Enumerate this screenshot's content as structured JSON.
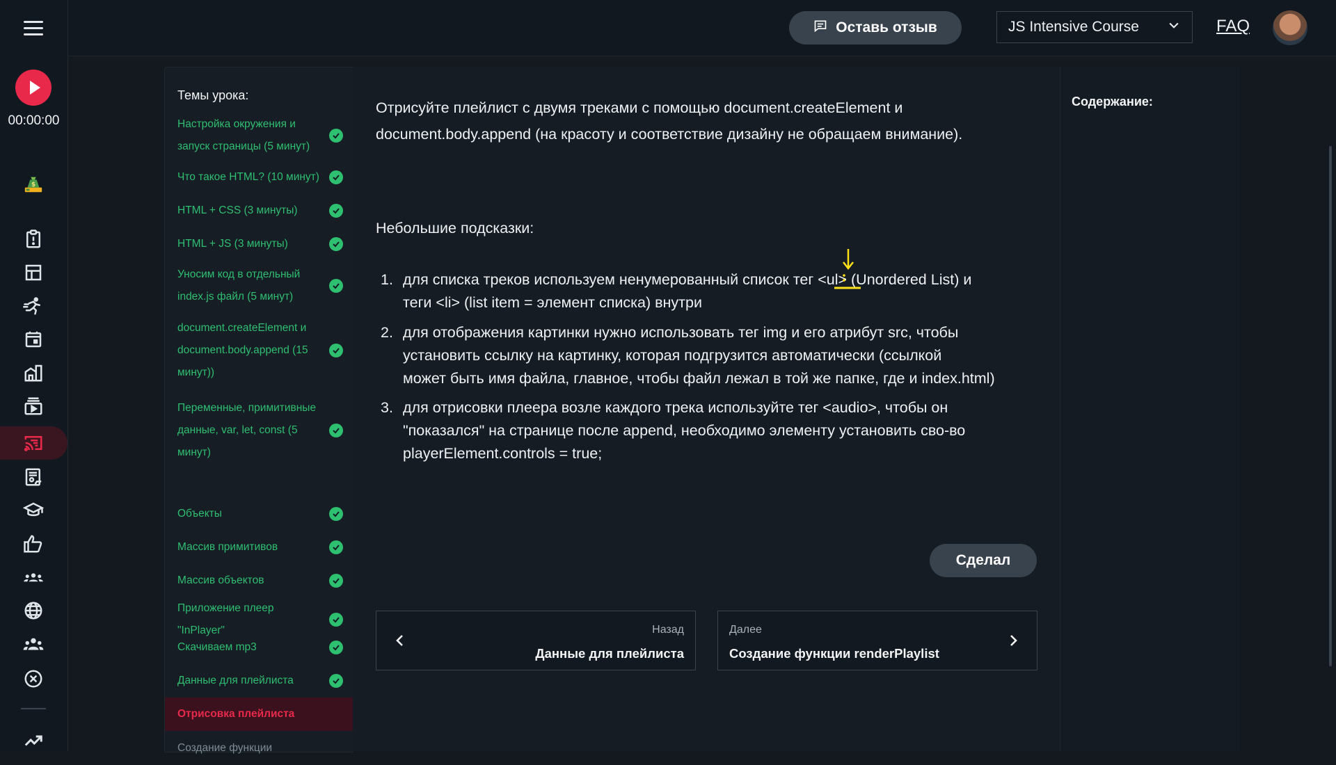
{
  "player": {
    "timer": "00:00:00"
  },
  "header": {
    "feedback_label": "Оставь отзыв",
    "course_selected": "JS Intensive Course",
    "faq_label": "FAQ"
  },
  "topics": {
    "title": "Темы урока:",
    "items": [
      {
        "label": "Настройка окружения и запуск страницы (5 минут)",
        "done": true
      },
      {
        "label": "Что такое HTML? (10 минут)",
        "done": true
      },
      {
        "label": "HTML + CSS (3 минуты)",
        "done": true
      },
      {
        "label": "HTML + JS (3 минуты)",
        "done": true
      },
      {
        "label": "Уносим код в отдельный index.js файл (5 минут)",
        "done": true
      },
      {
        "label": "document.createElement и document.body.append (15 минут))",
        "done": true
      },
      {
        "label": "Переменные, примитивные данные, var, let, const (5 минут)",
        "done": true
      },
      {
        "label": "Объекты",
        "done": true
      },
      {
        "label": "Массив примитивов",
        "done": true
      },
      {
        "label": "Массив объектов",
        "done": true
      },
      {
        "label": "Приложение плеер \"InPlayer\"",
        "done": true
      },
      {
        "label": "Скачиваем mp3",
        "done": true
      },
      {
        "label": "Данные для плейлиста",
        "done": true
      },
      {
        "label": "Отрисовка плейлиста",
        "done": false,
        "active": true
      },
      {
        "label": "Создание функции",
        "done": false
      }
    ]
  },
  "lesson": {
    "intro_line1": "Отрисуйте плейлист с двумя треками с помощью document.createElement и",
    "intro_line2": "document.body.append (на красоту и соответствие дизайну не обращаем внимание).",
    "hints_title": "Небольшие подсказки:",
    "hints": [
      {
        "num": "1.",
        "line1": "для списка треков используем ненумерованный список тег <ul> (Unordered List) и",
        "line2": "теги  <li> (list item = элемент списка) внутри",
        "line3": ""
      },
      {
        "num": "2.",
        "line1": "для отображения картинки нужно использовать тег img и его атрибут src, чтобы",
        "line2": "установить ссылку на картинку, которая подгрузится автоматически (ссылкой",
        "line3": "может быть имя файла, главное, чтобы файл лежал в той же папке, где и index.html)"
      },
      {
        "num": "3.",
        "line1": "для отрисовки плеера возле каждого трека используйте тег <audio>, чтобы он",
        "line2": "\"показался\" на странице после append, необходимо элементу установить сво-во",
        "line3": "playerElement.controls = true;"
      }
    ],
    "done_button": "Сделал",
    "prev": {
      "small": "Назад",
      "title": "Данные для плейлиста"
    },
    "next": {
      "small": "Далее",
      "title": "Создание функции renderPlaylist"
    }
  },
  "toc": {
    "title": "Содержание:"
  },
  "colors": {
    "accent": "#e8294a",
    "success": "#2fbf71",
    "annotation": "#ffe11a"
  },
  "rail_icons": [
    "menu-icon",
    "play-icon",
    "money-bag-icon",
    "clipboard-alert-icon",
    "dashboard-icon",
    "running-icon",
    "calendar-icon",
    "buildings-icon",
    "video-library-icon",
    "cast-icon",
    "news-icon",
    "graduation-cap-icon",
    "thumb-up-icon",
    "group-small-icon",
    "globe-icon",
    "team-icon",
    "cancel-circle-icon",
    "trending-up-icon"
  ]
}
